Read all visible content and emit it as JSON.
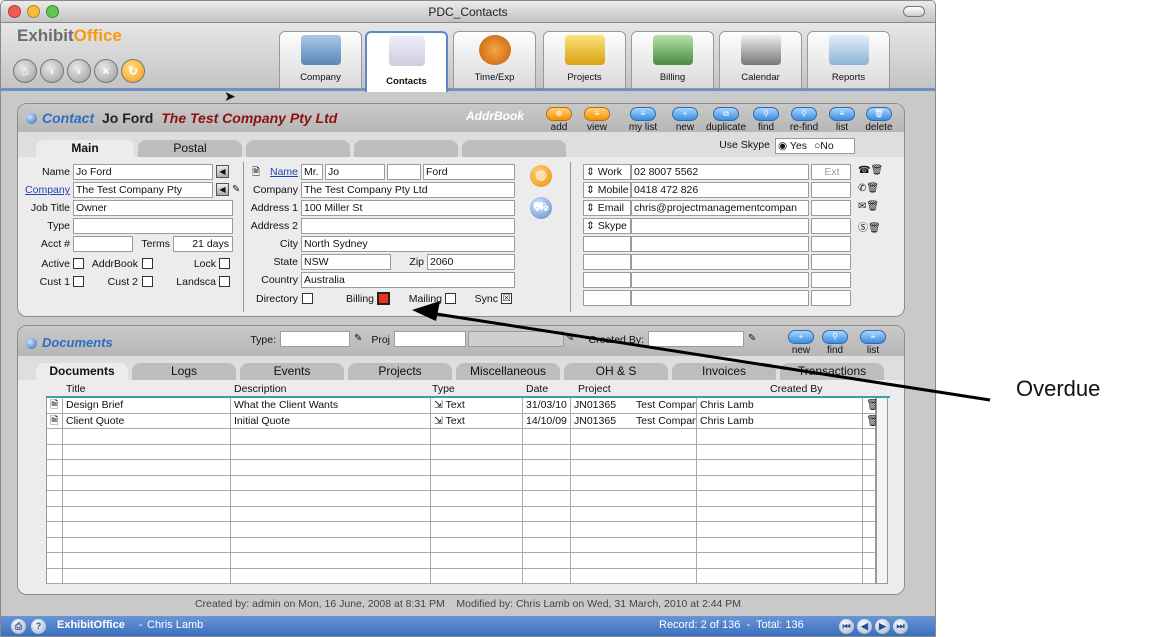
{
  "window": {
    "title": "PDC_Contacts"
  },
  "app": {
    "logo_left": "Exhibit",
    "logo_right": "Office"
  },
  "modules": [
    {
      "label": "Company",
      "icon": "company-icon"
    },
    {
      "label": "Contacts",
      "icon": "contacts-icon"
    },
    {
      "label": "Time/Exp",
      "icon": "time-exp-icon"
    },
    {
      "label": "Projects",
      "icon": "projects-icon"
    },
    {
      "label": "Billing",
      "icon": "billing-icon"
    },
    {
      "label": "Calendar",
      "icon": "calendar-icon"
    },
    {
      "label": "Reports",
      "icon": "reports-icon"
    }
  ],
  "contact": {
    "heading_label": "Contact",
    "heading_name": "Jo Ford",
    "heading_company": "The Test Company Pty Ltd",
    "addrbook_label": "AddrBook",
    "toolbar": [
      "add",
      "view",
      "my list",
      "new",
      "duplicate",
      "find",
      "re-find",
      "list",
      "delete"
    ],
    "tabs": [
      "Main",
      "Postal"
    ],
    "skype_label": "Use Skype",
    "skype_yes": "Yes",
    "skype_no": "No",
    "left": {
      "name_label": "Name",
      "name": "Jo Ford",
      "company_label": "Company",
      "company": "The Test Company Pty",
      "jobtitle_label": "Job Title",
      "jobtitle": "Owner",
      "type_label": "Type",
      "type": "",
      "acct_label": "Acct #",
      "acct": "",
      "terms_label": "Terms",
      "terms": "21 days",
      "active_label": "Active",
      "addrbook_label": "AddrBook",
      "lock_label": "Lock",
      "cust1_label": "Cust 1",
      "cust2_label": "Cust 2",
      "landsca_label": "Landsca"
    },
    "mid": {
      "name_label": "Name",
      "title": "Mr.",
      "first": "Jo",
      "middle": "",
      "last": "Ford",
      "company_label": "Company",
      "company": "The Test Company Pty Ltd",
      "addr1_label": "Address 1",
      "addr1": "100 Miller St",
      "addr2_label": "Address 2",
      "addr2": "",
      "city_label": "City",
      "city": "North Sydney",
      "state_label": "State",
      "state": "NSW",
      "zip_label": "Zip",
      "zip": "2060",
      "country_label": "Country",
      "country": "Australia",
      "directory_label": "Directory",
      "billing_label": "Billing",
      "mailing_label": "Mailing",
      "sync_label": "Sync"
    },
    "phones": [
      {
        "label": "Work",
        "value": "02 8007 5562",
        "ext": "Ext"
      },
      {
        "label": "Mobile",
        "value": "0418 472 826",
        "ext": ""
      },
      {
        "label": "Email",
        "value": "chris@projectmanagementcompan",
        "ext": ""
      },
      {
        "label": "Skype",
        "value": "",
        "ext": ""
      }
    ]
  },
  "documents": {
    "heading": "Documents",
    "type_label": "Type:",
    "proj_label": "Proj",
    "created_label": "Created By:",
    "toolbar": [
      "new",
      "find",
      "list"
    ],
    "tabs": [
      "Documents",
      "Logs",
      "Events",
      "Projects",
      "Miscellaneous",
      "OH & S",
      "Invoices",
      "Transactions"
    ],
    "columns": [
      "Title",
      "Description",
      "Type",
      "Date",
      "Project",
      "",
      "Created By"
    ],
    "rows": [
      {
        "title": "Design Brief",
        "description": "What the Client Wants",
        "type": "Text",
        "date": "31/03/10",
        "project": "JN01365",
        "company": "Test Company",
        "created_by": "Chris Lamb"
      },
      {
        "title": "Client Quote",
        "description": "Initial Quote",
        "type": "Text",
        "date": "14/10/09",
        "project": "JN01365",
        "company": "Test Company",
        "created_by": "Chris Lamb"
      }
    ]
  },
  "footer": {
    "audit": "Created by: admin on Mon, 16 June, 2008 at 8:31 PM    Modified by: Chris Lamb on Wed, 31 March, 2010 at 2:44 PM",
    "app_name": "ExhibitOffice",
    "user": "Chris Lamb",
    "record": "Record: 2 of 136  -  Total: 136"
  },
  "annotation": {
    "label": "Overdue"
  }
}
